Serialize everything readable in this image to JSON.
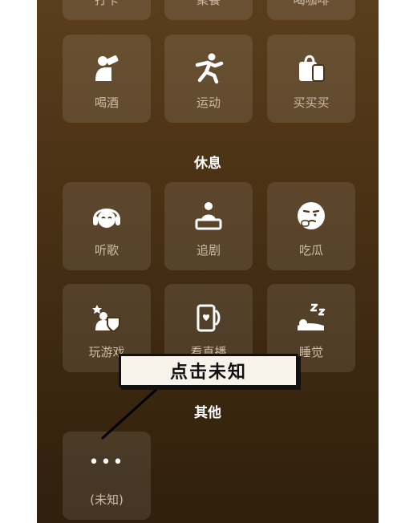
{
  "row0": {
    "labels": [
      "打卡",
      "聚餐",
      "喝咖啡"
    ]
  },
  "row1": {
    "labels": [
      "喝酒",
      "运动",
      "买买买"
    ]
  },
  "rest_section": {
    "title": "休息"
  },
  "row2": {
    "labels": [
      "听歌",
      "追剧",
      "吃瓜"
    ]
  },
  "row3": {
    "labels": [
      "玩游戏",
      "看直播",
      "睡觉"
    ]
  },
  "other_section": {
    "title": "其他"
  },
  "unknown": {
    "dots": "•••",
    "label": "(未知)"
  },
  "annotation": {
    "text": "点击未知"
  },
  "colors": {
    "tile_label": "#cdbca6",
    "section_title": "#ffffff",
    "bg_top": "#5a3e1c",
    "bg_bottom": "#2f1f0c"
  }
}
